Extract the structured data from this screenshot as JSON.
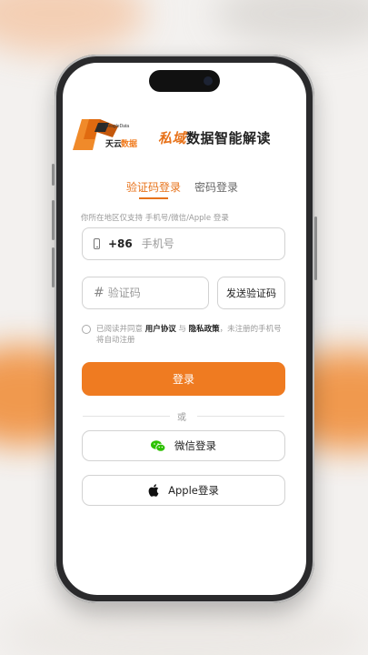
{
  "brand": {
    "logo_en": "BeagleData",
    "logo_cn_part1": "天云",
    "logo_cn_part2": "数据",
    "slogan_part1": "私域",
    "slogan_part2": "数据智能解读"
  },
  "tabs": [
    {
      "label": "验证码登录",
      "active": true
    },
    {
      "label": "密码登录",
      "active": false
    }
  ],
  "region_note": "你所在地区仅支持 手机号/微信/Apple 登录",
  "phone": {
    "prefix": "+86",
    "placeholder": "手机号",
    "value": ""
  },
  "code": {
    "placeholder": "验证码",
    "value": "",
    "send_label": "发送验证码"
  },
  "agreement": {
    "checked": false,
    "text_1": "已阅读并同意 ",
    "user_agreement": "用户协议",
    "text_2": " 与 ",
    "privacy_policy": "隐私政策",
    "text_3": "，未注册的手机号将自动注册"
  },
  "login_label": "登录",
  "or_label": "或",
  "wechat_label": "微信登录",
  "apple_label": "Apple登录",
  "colors": {
    "accent": "#ef7b21",
    "wechat": "#2dc100"
  },
  "icons": [
    "phone-icon",
    "hash-icon",
    "wechat-icon",
    "apple-icon",
    "logo-icon"
  ]
}
